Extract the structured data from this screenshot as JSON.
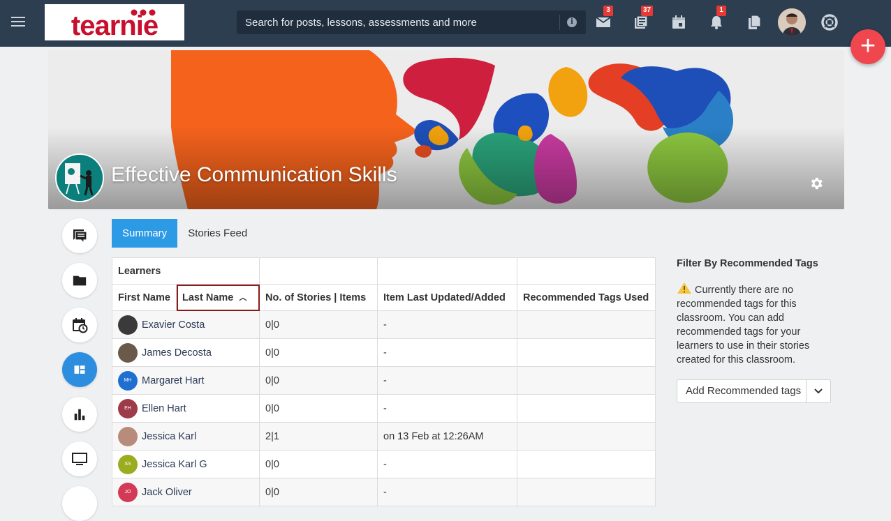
{
  "app": {
    "logo_text": "teamie"
  },
  "header": {
    "search_placeholder": "Search for posts, lessons, assessments and more",
    "badges": {
      "messages": "3",
      "newsfeed": "37",
      "notifications": "1"
    }
  },
  "classroom": {
    "title": "Effective Communication Skills"
  },
  "tabs": [
    "Summary",
    "Stories Feed"
  ],
  "table": {
    "group_header": "Learners",
    "columns": [
      "First Name",
      "Last Name",
      "No. of Stories | Items",
      "Item Last Updated/Added",
      "Recommended Tags Used"
    ],
    "rows": [
      {
        "name": "Exavier Costa",
        "initials": "",
        "count": "0|0",
        "updated": "-",
        "tags": "",
        "color": "#3a3a3a"
      },
      {
        "name": "James Decosta",
        "initials": "",
        "count": "0|0",
        "updated": "-",
        "tags": "",
        "color": "#6b5a4a"
      },
      {
        "name": "Margaret Hart",
        "initials": "MH",
        "count": "0|0",
        "updated": "-",
        "tags": "",
        "color": "#1e6fd0"
      },
      {
        "name": "Ellen Hart",
        "initials": "EH",
        "count": "0|0",
        "updated": "-",
        "tags": "",
        "color": "#9e3b49"
      },
      {
        "name": "Jessica Karl",
        "initials": "",
        "count": "2|1",
        "updated": "on 13 Feb at 12:26AM",
        "tags": "",
        "color": "#b88c7a"
      },
      {
        "name": "Jessica Karl G",
        "initials": "SS",
        "count": "0|0",
        "updated": "-",
        "tags": "",
        "color": "#9aad1e"
      },
      {
        "name": "Jack Oliver",
        "initials": "JO",
        "count": "0|0",
        "updated": "-",
        "tags": "",
        "color": "#d23a55"
      }
    ]
  },
  "filter": {
    "title": "Filter By Recommended Tags",
    "message": "Currently there are no recommended tags for this classroom. You can add recommended tags for your learners to use in their stories created for this classroom.",
    "button": "Add Recommended tags"
  },
  "colors": {
    "topbar": "#2c3e50",
    "accent": "#2d9ae6",
    "fab": "#f0474e",
    "logo": "#c8102e"
  }
}
